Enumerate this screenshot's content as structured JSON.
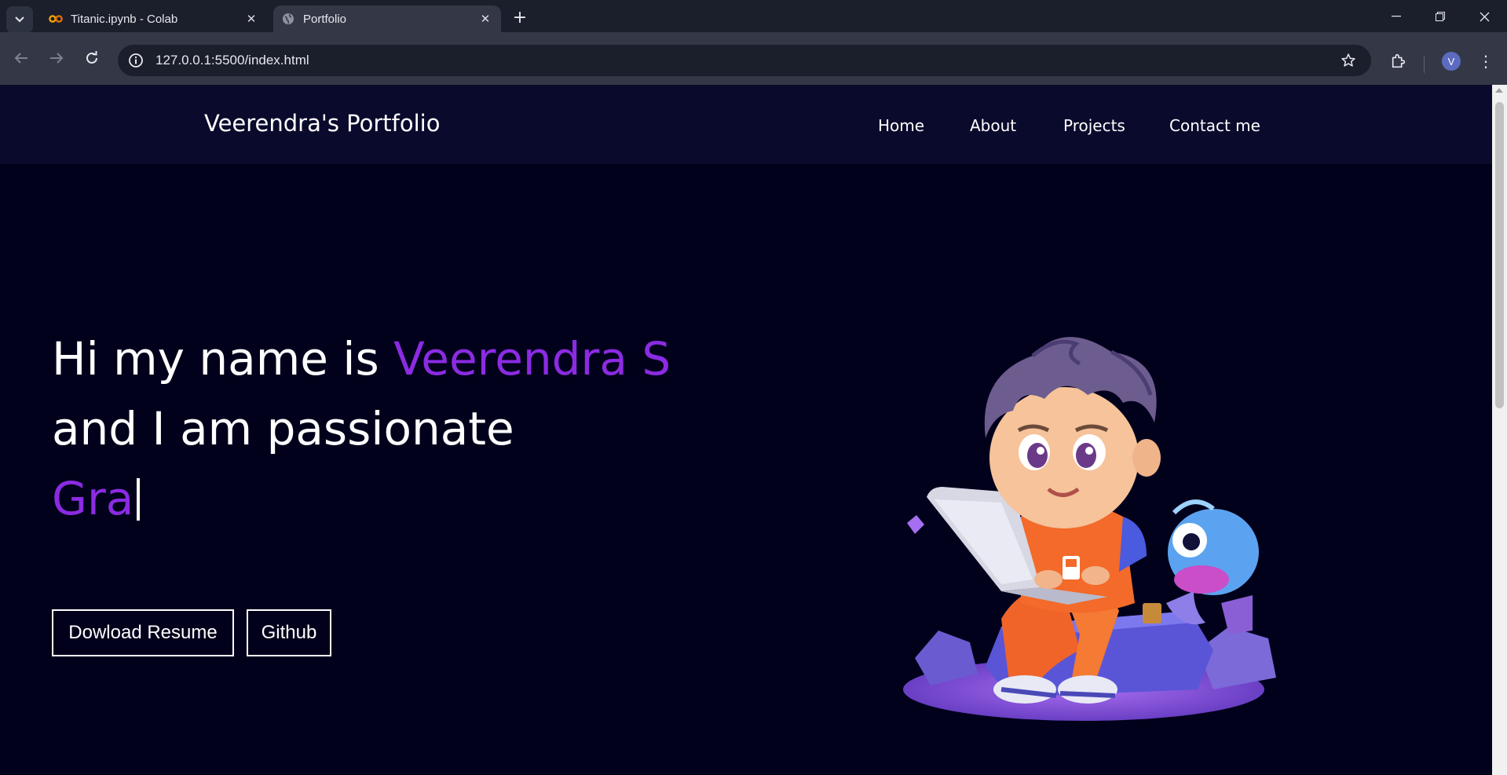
{
  "browser": {
    "tabs": [
      {
        "title": "Titanic.ipynb - Colab",
        "icon": "colab-icon",
        "active": false
      },
      {
        "title": "Portfolio",
        "icon": "globe-icon",
        "active": true
      }
    ],
    "url": "127.0.0.1:5500/index.html",
    "profile_initial": "V",
    "colors": {
      "tab_bar": "#1b1f2b",
      "toolbar": "#343846",
      "profile": "#5c6bc0"
    }
  },
  "site": {
    "brand": "Veerendra's Portfolio",
    "nav": [
      "Home",
      "About",
      "Projects",
      "Contact me"
    ],
    "hero": {
      "line1_prefix": "Hi my name is ",
      "line1_name": "Veerendra S",
      "line2": "and I am passionate",
      "typed_text": "Gra"
    },
    "buttons": {
      "resume": "Dowload Resume",
      "github": "Github"
    },
    "colors": {
      "background": "#02011c",
      "header": "#0a0a2c",
      "accent": "#8b2be2",
      "text": "#ffffff"
    }
  }
}
